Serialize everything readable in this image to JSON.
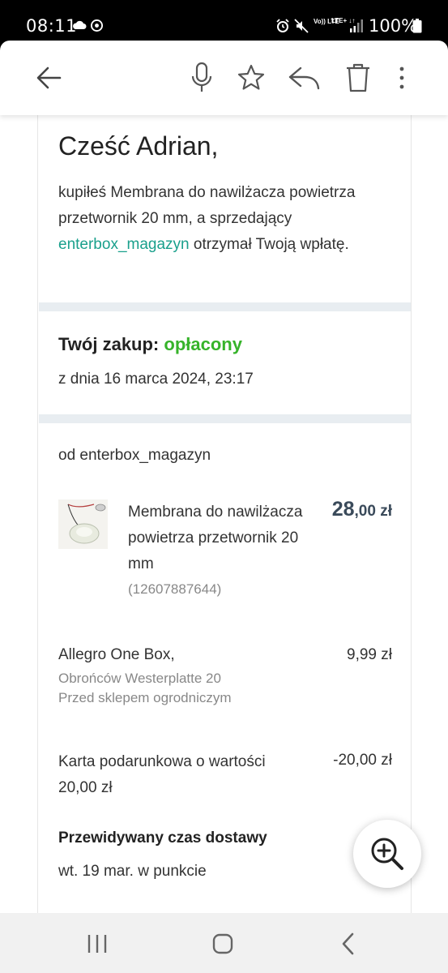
{
  "status_bar": {
    "time": "08:11",
    "volte": "Vo)) LTE",
    "lte": "LTE+ ↓↑",
    "battery": "100%",
    "icons": [
      "cloud-icon",
      "chrome-icon",
      "alarm-icon",
      "mute-icon",
      "signal-icon",
      "battery-icon"
    ]
  },
  "toolbar": {
    "icons": [
      "back-arrow-icon",
      "microphone-icon",
      "star-icon",
      "reply-icon",
      "trash-icon",
      "more-vert-icon"
    ]
  },
  "email": {
    "greeting": "Cześć Adrian,",
    "intro_before": "kupiłeś Membrana do nawilżacza powietrza przetwornik 20 mm, a sprzedający ",
    "seller_link": "enterbox_magazyn",
    "intro_after": " otrzymał Twoją wpłatę.",
    "purchase_label": "Twój zakup:",
    "purchase_status": "opłacony",
    "purchase_date": "z dnia 16 marca 2024, 23:17",
    "seller_line": "od enterbox_magazyn",
    "product": {
      "name": "Membrana do nawilżacza powietrza przetwornik 20 mm",
      "id": "(12607887644)",
      "price_main": "28",
      "price_rest": ",00 zł"
    },
    "shipping": {
      "name": "Allegro One Box,",
      "price": "9,99 zł",
      "address1": "Obrońców Westerplatte 20",
      "address2": "Przed sklepem ogrodniczym"
    },
    "gift_card": {
      "name": "Karta podarunkowa o wartości 20,00 zł",
      "value": "-20,00 zł"
    },
    "delivery": {
      "label": "Przewidywany czas dostawy",
      "value": "wt. 19 mar. w punkcie"
    }
  },
  "colors": {
    "link": "#1aa08c",
    "status_paid": "#36b32a",
    "price": "#3a4a5a",
    "divider": "#e8edf1"
  },
  "fab": {
    "icon": "zoom-in-icon"
  },
  "nav_bar": {
    "icons": [
      "recent-apps-icon",
      "home-icon",
      "back-icon"
    ]
  }
}
